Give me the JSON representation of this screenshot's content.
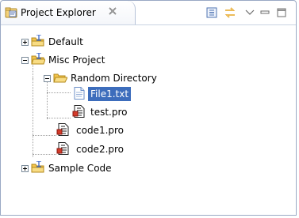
{
  "view": {
    "title": "Project Explorer",
    "close_icon": "close-x-icon",
    "toolbar": [
      "collapse-all-icon",
      "link-with-editor-icon",
      "view-menu-chevron-icon",
      "minimize-icon",
      "maximize-icon"
    ]
  },
  "tree": {
    "items": [
      {
        "label": "Default",
        "type": "project",
        "expanded": false
      },
      {
        "label": "Misc Project",
        "type": "project",
        "expanded": true
      },
      {
        "label": "Random Directory",
        "type": "folder",
        "expanded": true
      },
      {
        "label": "File1.txt",
        "type": "text-file",
        "selected": true
      },
      {
        "label": "test.pro",
        "type": "pro-file"
      },
      {
        "label": "code1.pro",
        "type": "pro-file"
      },
      {
        "label": "code2.pro",
        "type": "pro-file"
      },
      {
        "label": "Sample Code",
        "type": "project",
        "expanded": false
      }
    ]
  },
  "colors": {
    "selection": "#3d6dbc",
    "border": "#9aa9c4",
    "folder": "#f3c44d"
  }
}
